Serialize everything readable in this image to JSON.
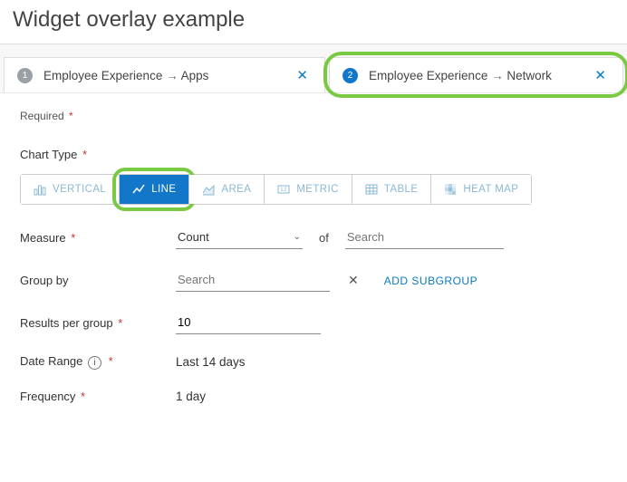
{
  "title": "Widget overlay example",
  "tabs": [
    {
      "num": "1",
      "a": "Employee Experience",
      "b": "Apps"
    },
    {
      "num": "2",
      "a": "Employee Experience",
      "b": "Network"
    }
  ],
  "requiredNote": "Required",
  "chartTypeLabel": "Chart Type",
  "chartButtons": {
    "vertical": "VERTICAL",
    "line": "LINE",
    "area": "AREA",
    "metric": "METRIC",
    "table": "TABLE",
    "heatmap": "HEAT MAP"
  },
  "measure": {
    "label": "Measure",
    "value": "Count",
    "of": "of",
    "placeholder": "Search"
  },
  "groupBy": {
    "label": "Group by",
    "placeholder": "Search",
    "addSubgroup": "ADD SUBGROUP"
  },
  "resultsPerGroup": {
    "label": "Results per group",
    "value": "10"
  },
  "dateRange": {
    "label": "Date Range",
    "value": "Last 14 days"
  },
  "frequency": {
    "label": "Frequency",
    "value": "1 day"
  }
}
